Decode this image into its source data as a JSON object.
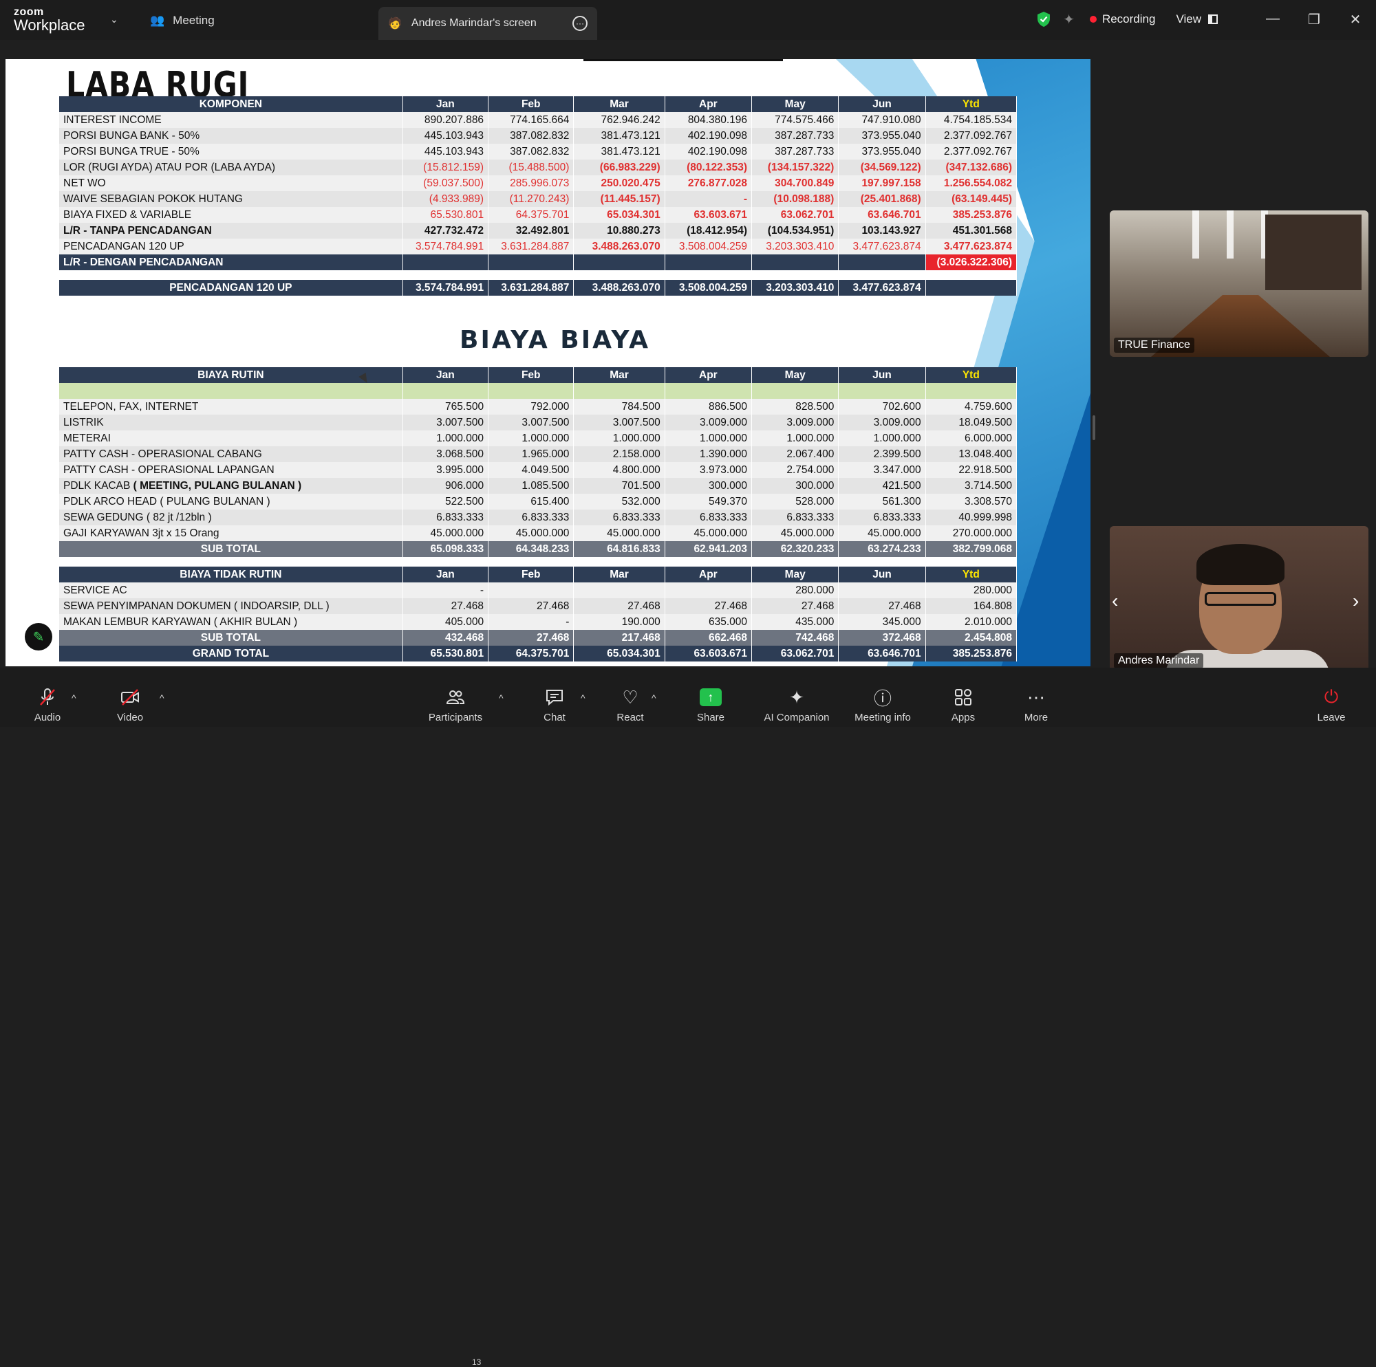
{
  "app": {
    "logo_top": "zoom",
    "logo_bottom": "Workplace"
  },
  "header": {
    "meeting_label": "Meeting",
    "screen_tab": "Andres Marindar's screen",
    "recording_label": "Recording",
    "view_label": "View"
  },
  "slide": {
    "title_laba_rugi": "LABA RUGI",
    "title_biaya": "BIAYA BIAYA",
    "months": [
      "Jan",
      "Feb",
      "Mar",
      "Apr",
      "May",
      "Jun",
      "Ytd"
    ],
    "lr_header": "KOMPONEN",
    "lr_rows": [
      {
        "label": "INTEREST INCOME",
        "vals": [
          "890.207.886",
          "774.165.664",
          "762.946.242",
          "804.380.196",
          "774.575.466",
          "747.910.080",
          "4.754.185.534"
        ]
      },
      {
        "label": "PORSI BUNGA BANK - 50%",
        "vals": [
          "445.103.943",
          "387.082.832",
          "381.473.121",
          "402.190.098",
          "387.287.733",
          "373.955.040",
          "2.377.092.767"
        ]
      },
      {
        "label": "PORSI BUNGA TRUE - 50%",
        "vals": [
          "445.103.943",
          "387.082.832",
          "381.473.121",
          "402.190.098",
          "387.287.733",
          "373.955.040",
          "2.377.092.767"
        ]
      },
      {
        "label": "LOR  (RUGI AYDA) ATAU POR (LABA AYDA)",
        "vals": [
          "(15.812.159)",
          "(15.488.500)",
          "(66.983.229)",
          "(80.122.353)",
          "(134.157.322)",
          "(34.569.122)",
          "(347.132.686)"
        ]
      },
      {
        "label": "NET WO",
        "vals": [
          "(59.037.500)",
          "285.996.073",
          "250.020.475",
          "276.877.028",
          "304.700.849",
          "197.997.158",
          "1.256.554.082"
        ]
      },
      {
        "label": "WAIVE SEBAGIAN POKOK HUTANG",
        "vals": [
          "(4.933.989)",
          "(11.270.243)",
          "(11.445.157)",
          "-",
          "(10.098.188)",
          "(25.401.868)",
          "(63.149.445)"
        ]
      },
      {
        "label": "BIAYA FIXED & VARIABLE",
        "vals": [
          "65.530.801",
          "64.375.701",
          "65.034.301",
          "63.603.671",
          "63.062.701",
          "63.646.701",
          "385.253.876"
        ]
      },
      {
        "label": "L/R - TANPA PENCADANGAN",
        "vals": [
          "427.732.472",
          "32.492.801",
          "10.880.273",
          "(18.412.954)",
          "(104.534.951)",
          "103.143.927",
          "451.301.568"
        ]
      },
      {
        "label": "PENCADANGAN 120 UP",
        "vals": [
          "3.574.784.991",
          "3.631.284.887",
          "3.488.263.070",
          "3.508.004.259",
          "3.203.303.410",
          "3.477.623.874",
          "3.477.623.874"
        ]
      }
    ],
    "lr_dengan": {
      "label": "L/R - DENGAN PENCADANGAN",
      "ytd": "(3.026.322.306)"
    },
    "pencadangan_summary": {
      "label": "PENCADANGAN 120 UP",
      "vals": [
        "3.574.784.991",
        "3.631.284.887",
        "3.488.263.070",
        "3.508.004.259",
        "3.203.303.410",
        "3.477.623.874"
      ]
    },
    "rutin_header": "BIAYA RUTIN",
    "rutin_rows": [
      {
        "label": "TELEPON, FAX, INTERNET",
        "vals": [
          "765.500",
          "792.000",
          "784.500",
          "886.500",
          "828.500",
          "702.600",
          "4.759.600"
        ]
      },
      {
        "label": "LISTRIK",
        "vals": [
          "3.007.500",
          "3.007.500",
          "3.007.500",
          "3.009.000",
          "3.009.000",
          "3.009.000",
          "18.049.500"
        ]
      },
      {
        "label": "METERAI",
        "vals": [
          "1.000.000",
          "1.000.000",
          "1.000.000",
          "1.000.000",
          "1.000.000",
          "1.000.000",
          "6.000.000"
        ]
      },
      {
        "label": "PATTY CASH - OPERASIONAL CABANG",
        "vals": [
          "3.068.500",
          "1.965.000",
          "2.158.000",
          "1.390.000",
          "2.067.400",
          "2.399.500",
          "13.048.400"
        ]
      },
      {
        "label": "PATTY CASH - OPERASIONAL LAPANGAN",
        "vals": [
          "3.995.000",
          "4.049.500",
          "4.800.000",
          "3.973.000",
          "2.754.000",
          "3.347.000",
          "22.918.500"
        ]
      },
      {
        "label_main": "PDLK KACAB ",
        "label_bold": "( MEETING, PULANG BULANAN )",
        "vals": [
          "906.000",
          "1.085.500",
          "701.500",
          "300.000",
          "300.000",
          "421.500",
          "3.714.500"
        ]
      },
      {
        "label": "PDLK ARCO HEAD ( PULANG BULANAN )",
        "vals": [
          "522.500",
          "615.400",
          "532.000",
          "549.370",
          "528.000",
          "561.300",
          "3.308.570"
        ]
      },
      {
        "label": "SEWA GEDUNG ( 82 jt /12bln  )",
        "vals": [
          "6.833.333",
          "6.833.333",
          "6.833.333",
          "6.833.333",
          "6.833.333",
          "6.833.333",
          "40.999.998"
        ]
      },
      {
        "label": "GAJI KARYAWAN  3jt x 15 Orang",
        "vals": [
          "45.000.000",
          "45.000.000",
          "45.000.000",
          "45.000.000",
          "45.000.000",
          "45.000.000",
          "270.000.000"
        ]
      }
    ],
    "rutin_subtotal": {
      "label": "SUB TOTAL",
      "vals": [
        "65.098.333",
        "64.348.233",
        "64.816.833",
        "62.941.203",
        "62.320.233",
        "63.274.233",
        "382.799.068"
      ]
    },
    "tidak_header": "BIAYA TIDAK RUTIN",
    "tidak_rows": [
      {
        "label": "SERVICE AC",
        "vals": [
          "-",
          "",
          "",
          "",
          "280.000",
          "",
          "280.000"
        ]
      },
      {
        "label": "SEWA PENYIMPANAN DOKUMEN ( INDOARSIP, DLL )",
        "vals": [
          "27.468",
          "27.468",
          "27.468",
          "27.468",
          "27.468",
          "27.468",
          "164.808"
        ]
      },
      {
        "label": "MAKAN LEMBUR KARYAWAN ( AKHIR BULAN )",
        "vals": [
          "405.000",
          "-",
          "190.000",
          "635.000",
          "435.000",
          "345.000",
          "2.010.000"
        ]
      }
    ],
    "tidak_subtotal": {
      "label": "SUB TOTAL",
      "vals": [
        "432.468",
        "27.468",
        "217.468",
        "662.468",
        "742.468",
        "372.468",
        "2.454.808"
      ]
    },
    "grand_total": {
      "label": "GRAND TOTAL",
      "vals": [
        "65.530.801",
        "64.375.701",
        "65.034.301",
        "63.603.671",
        "63.062.701",
        "63.646.701",
        "385.253.876"
      ]
    }
  },
  "participants": [
    {
      "name": "TRUE Finance"
    },
    {
      "name": "Andres Marindar"
    }
  ],
  "toolbar": {
    "audio": "Audio",
    "video": "Video",
    "participants": "Participants",
    "participants_count": "13",
    "chat": "Chat",
    "react": "React",
    "share": "Share",
    "ai": "AI Companion",
    "info": "Meeting info",
    "apps": "Apps",
    "more": "More",
    "leave": "Leave"
  },
  "colors": {
    "header_navy": "#2d3d55",
    "negative_red": "#e03030",
    "ytd_yellow": "#ffe600",
    "share_green": "#23c14d",
    "recording_red": "#ff2233"
  }
}
